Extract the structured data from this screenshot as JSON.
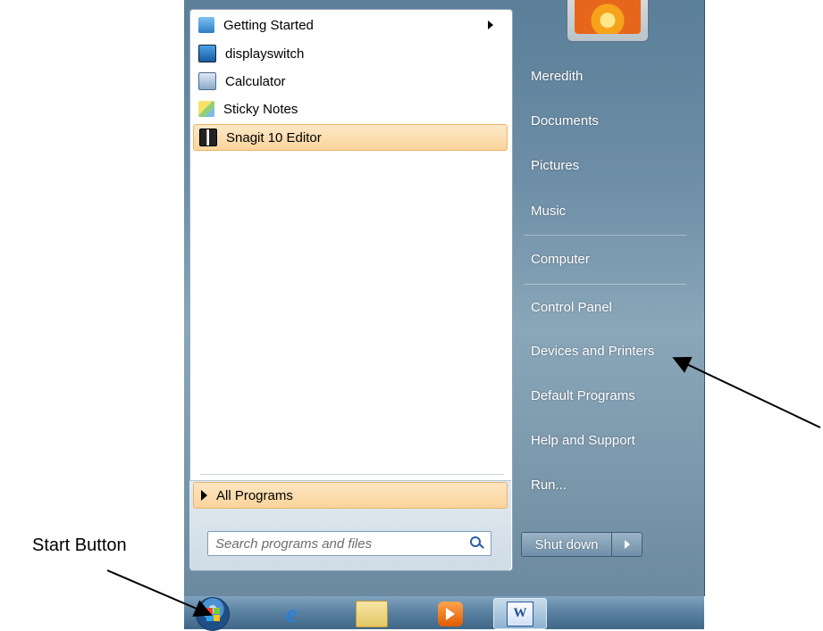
{
  "programs": [
    {
      "label": "Getting Started",
      "icon": "getting-started-icon",
      "has_submenu": true,
      "highlighted": false
    },
    {
      "label": "displayswitch",
      "icon": "display-switch-icon",
      "has_submenu": false,
      "highlighted": false
    },
    {
      "label": "Calculator",
      "icon": "calculator-icon",
      "has_submenu": false,
      "highlighted": false
    },
    {
      "label": "Sticky Notes",
      "icon": "sticky-notes-icon",
      "has_submenu": false,
      "highlighted": false
    },
    {
      "label": "Snagit 10 Editor",
      "icon": "snagit-icon",
      "has_submenu": false,
      "highlighted": true
    }
  ],
  "all_programs_label": "All Programs",
  "search": {
    "placeholder": "Search programs and files",
    "value": ""
  },
  "right_links": [
    {
      "label": "Meredith"
    },
    {
      "label": "Documents"
    },
    {
      "label": "Pictures"
    },
    {
      "label": "Music"
    },
    {
      "label": "Computer"
    },
    {
      "label": "Control Panel"
    },
    {
      "label": "Devices and Printers"
    },
    {
      "label": "Default Programs"
    },
    {
      "label": "Help and Support"
    },
    {
      "label": "Run..."
    }
  ],
  "shutdown_label": "Shut down",
  "taskbar": {
    "items": [
      {
        "icon": "windows-start-orb-icon"
      },
      {
        "icon": "internet-explorer-icon"
      },
      {
        "icon": "windows-explorer-icon"
      },
      {
        "icon": "media-player-icon"
      },
      {
        "icon": "microsoft-word-icon",
        "active": true
      }
    ]
  },
  "annotation": {
    "label": "Start Button"
  },
  "colors": {
    "highlight": "#fbd49a",
    "panel": "#6d8ea6",
    "taskbar": "#5d83a3"
  }
}
